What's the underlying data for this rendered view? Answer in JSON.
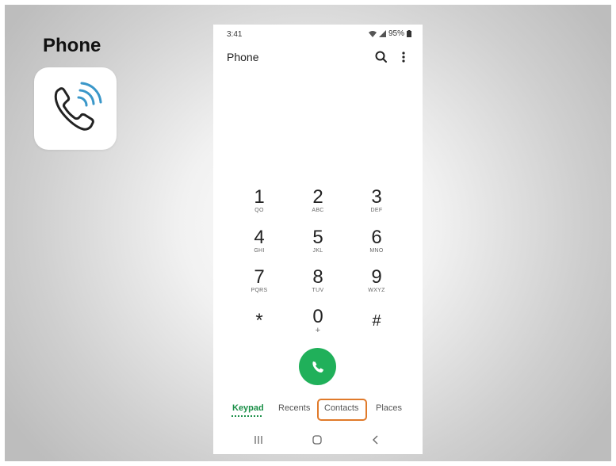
{
  "overlay": {
    "app_label": "Phone",
    "app_icon": "phone-call-icon"
  },
  "status_bar": {
    "time": "3:41",
    "battery": "95%",
    "icons": [
      "wifi-icon",
      "signal-icon",
      "battery-icon"
    ]
  },
  "header": {
    "title": "Phone",
    "search_icon": "search-icon",
    "more_icon": "more-vertical-icon"
  },
  "keypad": [
    {
      "digit": "1",
      "letters": "QO"
    },
    {
      "digit": "2",
      "letters": "ABC"
    },
    {
      "digit": "3",
      "letters": "DEF"
    },
    {
      "digit": "4",
      "letters": "GHI"
    },
    {
      "digit": "5",
      "letters": "JKL"
    },
    {
      "digit": "6",
      "letters": "MNO"
    },
    {
      "digit": "7",
      "letters": "PQRS"
    },
    {
      "digit": "8",
      "letters": "TUV"
    },
    {
      "digit": "9",
      "letters": "WXYZ"
    },
    {
      "digit": "*",
      "letters": ""
    },
    {
      "digit": "0",
      "letters": "+"
    },
    {
      "digit": "#",
      "letters": ""
    }
  ],
  "call_button_icon": "phone-icon",
  "tabs": {
    "keypad": "Keypad",
    "recents": "Recents",
    "contacts": "Contacts",
    "places": "Places",
    "active": "Keypad",
    "highlighted": "Contacts"
  },
  "colors": {
    "accent_green": "#1a8f47",
    "call_green": "#20b05a",
    "highlight_orange": "#e07a2a"
  },
  "nav_bar": [
    "recent-apps-icon",
    "home-icon",
    "back-icon"
  ]
}
